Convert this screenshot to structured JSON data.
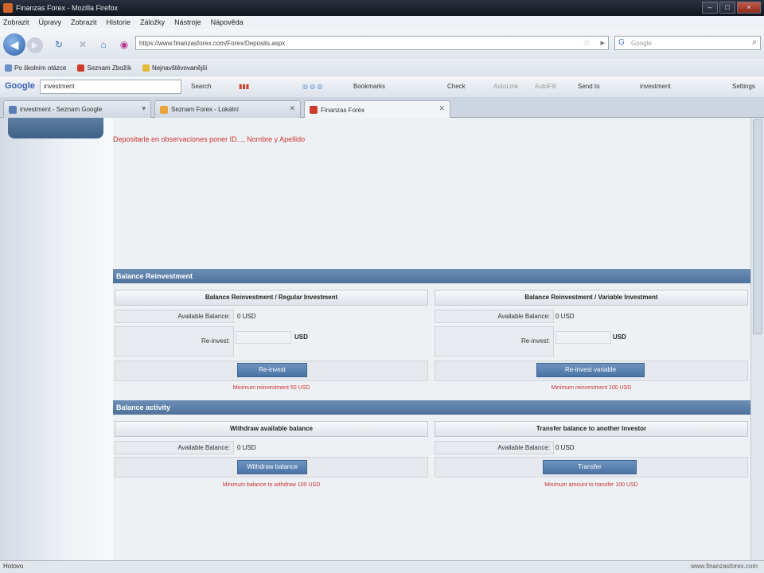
{
  "window": {
    "title": "Finanzas Forex - Mozilla Firefox",
    "controls": {
      "minimize": "–",
      "maximize": "□",
      "close": "×"
    }
  },
  "menu": [
    "Zobrazit",
    "Úpravy",
    "Zobrazit",
    "Historie",
    "Záložky",
    "Nástroje",
    "Nápověda"
  ],
  "nav": {
    "url": "https://www.finanzasforex.com/Forex/Deposits.aspx",
    "search_placeholder": "Google"
  },
  "bookmarks": [
    {
      "label": "Po školním otázce",
      "color": "#6a8fc4"
    },
    {
      "label": "Seznam Zbožík",
      "color": "#cc3b2b"
    },
    {
      "label": "Nejnavštěvovanější",
      "color": "#e6b83a"
    }
  ],
  "google_toolbar": {
    "logo": "Google",
    "query": "investment",
    "items": [
      "Search",
      "Bookmarks",
      "Check",
      "AutoLink",
      "AutoFill",
      "Send to",
      "investment",
      "Settings"
    ]
  },
  "tabs": [
    {
      "label": "investment - Seznam Google",
      "active": false,
      "color": "#5b7fb5"
    },
    {
      "label": "Seznam Forex - Lokální",
      "active": false,
      "color": "#e8a33a"
    },
    {
      "label": "Finanzas Forex",
      "active": true,
      "color": "#cc3b2b"
    }
  ],
  "notice": "Depositarle en observaciones poner ID..., Nombre y Apellido",
  "balance_reinvestment": {
    "header": "Balance Reinvestment",
    "regular": {
      "title": "Balance Reinvestment / Regular Investment",
      "available_label": "Available Balance:",
      "available_value": "0 USD",
      "reinvest_label": "Re-invest:",
      "unit": "USD",
      "button": "Re-invest",
      "warning": "Minimum reinvestment 50 USD"
    },
    "variable": {
      "title": "Balance Reinvestment / Variable Investment",
      "available_label": "Available Balance:",
      "available_value": "0 USD",
      "reinvest_label": "Re-invest:",
      "unit": "USD",
      "button": "Re-invest variable",
      "warning": "Minimum reinvestment 100 USD"
    }
  },
  "balance_activity": {
    "header": "Balance activity",
    "withdraw": {
      "title": "Withdraw available balance",
      "available_label": "Available Balance:",
      "available_value": "0 USD",
      "button": "Withdraw balance",
      "warning": "Minimum balance to withdraw 100 USD"
    },
    "transfer": {
      "title": "Transfer balance to another Investor",
      "available_label": "Available Balance:",
      "available_value": "0 USD",
      "button": "Transfer",
      "warning": "Minimum amount to transfer 100 USD"
    }
  },
  "status": {
    "left": "Hotovo",
    "right": "www.finanzasforex.com"
  }
}
